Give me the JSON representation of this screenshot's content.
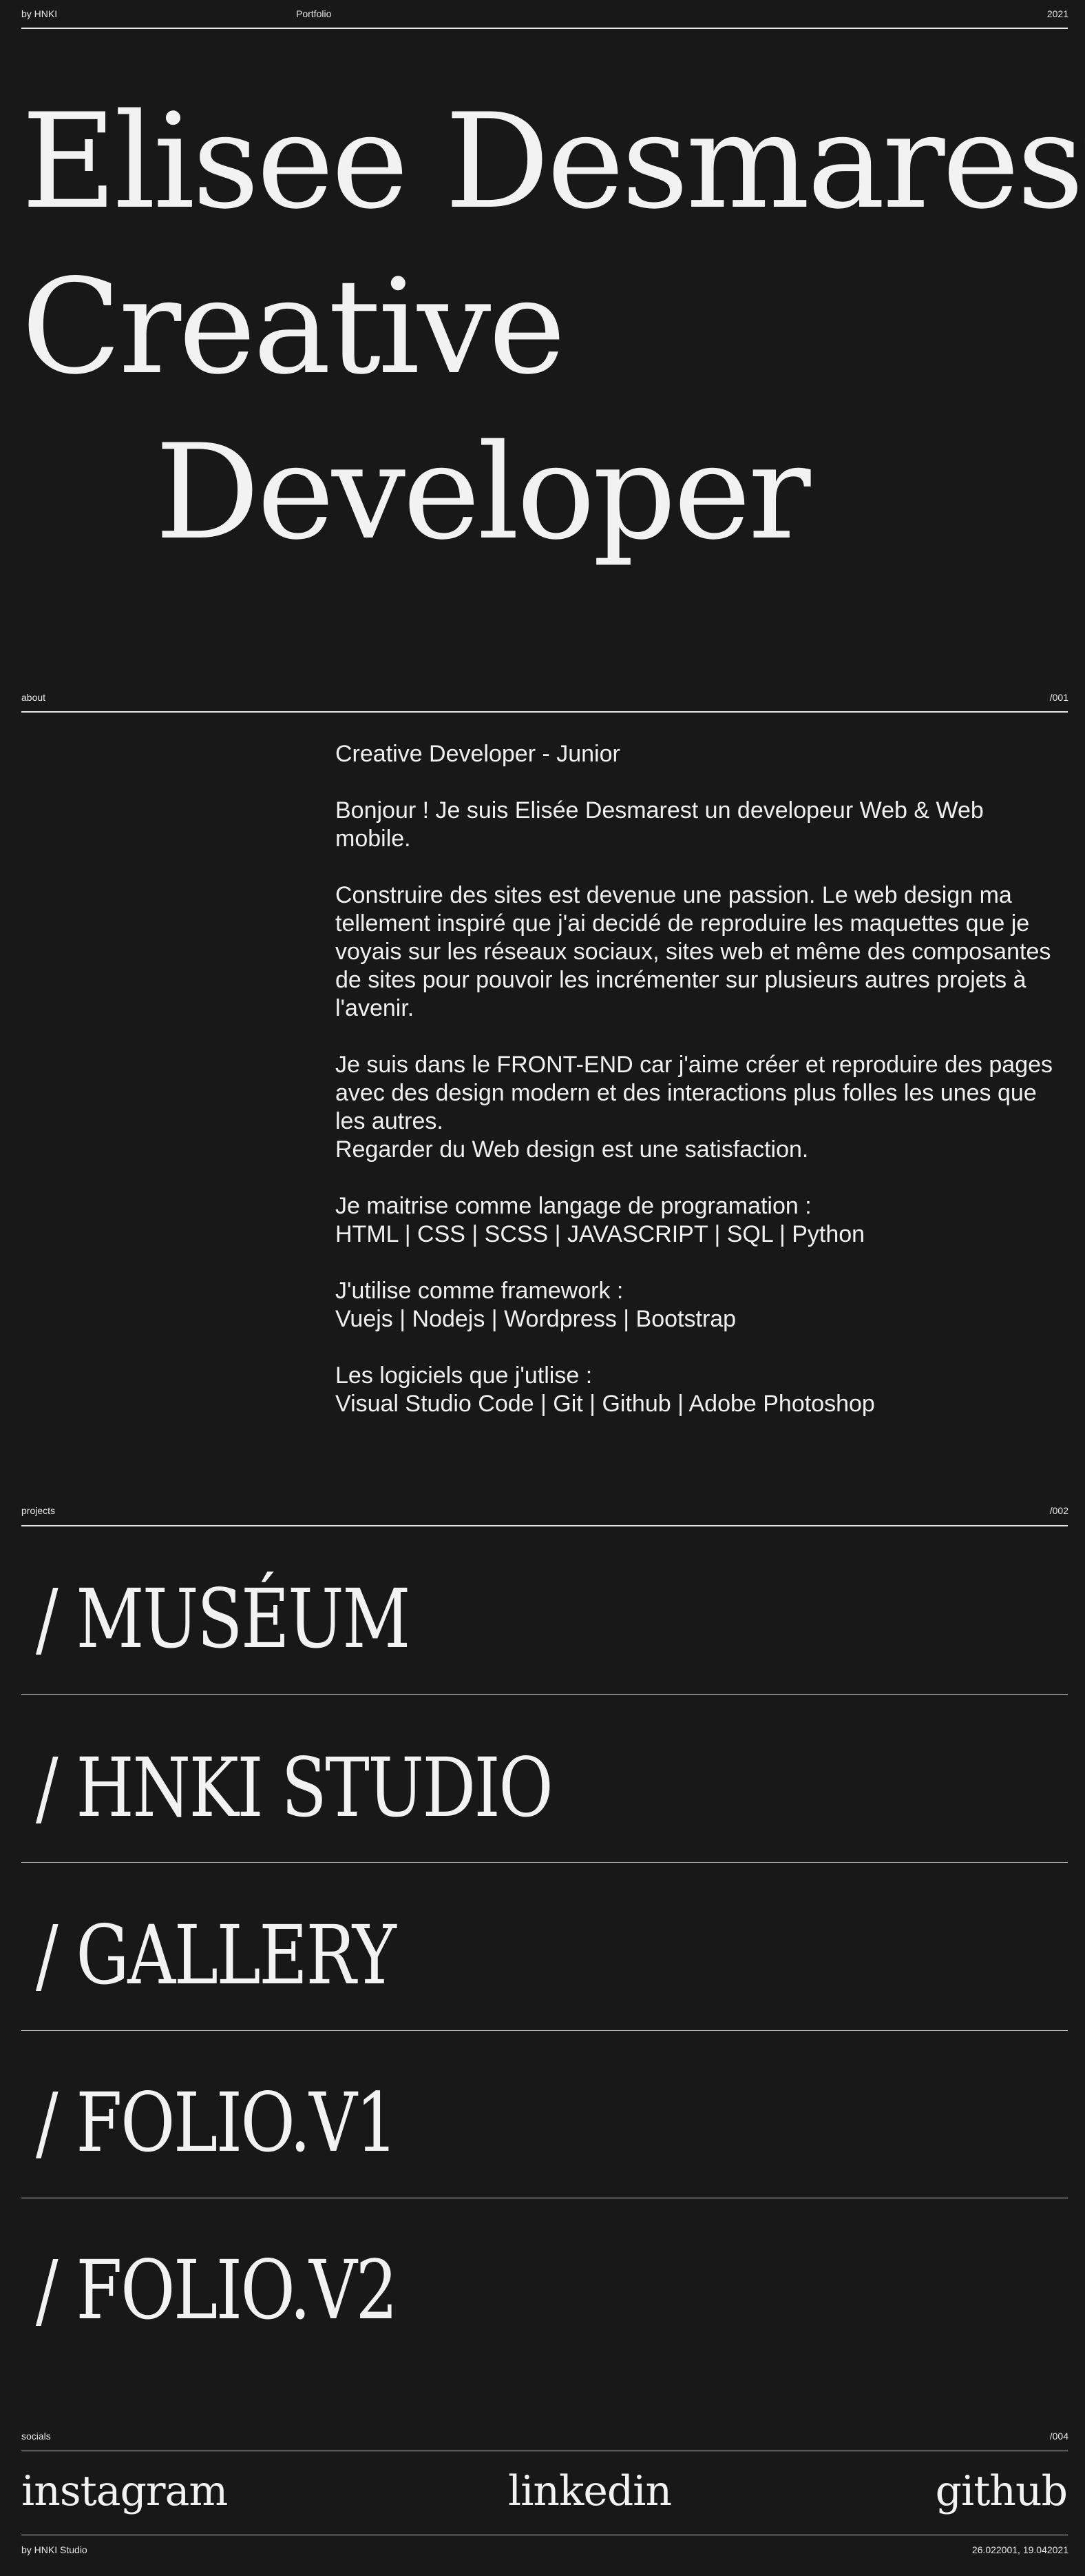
{
  "topbar": {
    "by": "by HNKI",
    "portfolio": "Portfolio",
    "year": "2021"
  },
  "hero": {
    "line1": "Elisee Desmarest",
    "line2": "Creative",
    "line3": "Developer"
  },
  "about": {
    "label": "about",
    "number": "/001",
    "title": "Creative Developer - Junior",
    "p1": "Bonjour ! Je suis Elisée Desmarest un developeur Web & Web mobile.",
    "p2": "Construire des sites est devenue une passion. Le web design ma tellement inspiré que j'ai decidé de reproduire les maquettes que je voyais sur les réseaux sociaux, sites web et même des composantes de sites pour pouvoir les incrémenter sur plusieurs autres projets à l'avenir.",
    "p3a": "Je suis dans le FRONT-END car j'aime créer et reproduire des pages avec des design modern et des interactions plus folles les unes que les autres.",
    "p3b": "Regarder du Web design est une satisfaction.",
    "lang_title": "Je maitrise comme langage de programation :",
    "lang_list": "HTML | CSS | SCSS | JAVASCRIPT | SQL | Python",
    "fw_title": "J'utilise comme framework :",
    "fw_list": "Vuejs | Nodejs | Wordpress | Bootstrap",
    "sw_title": "Les logiciels que j'utlise :",
    "sw_list": "Visual Studio Code | Git | Github | Adobe Photoshop"
  },
  "projects": {
    "label": "projects",
    "number": "/002",
    "items": [
      "/ MUSÉUM",
      "/ HNKI STUDIO",
      "/ GALLERY",
      "/ FOLIO.V1",
      "/ FOLIO.V2"
    ]
  },
  "socials": {
    "label": "socials",
    "number": "/004",
    "instagram": "instagram",
    "linkedin": "linkedin",
    "github": "github"
  },
  "footer": {
    "studio": "by HNKI Studio",
    "dates": "26.022001, 19.042021"
  }
}
